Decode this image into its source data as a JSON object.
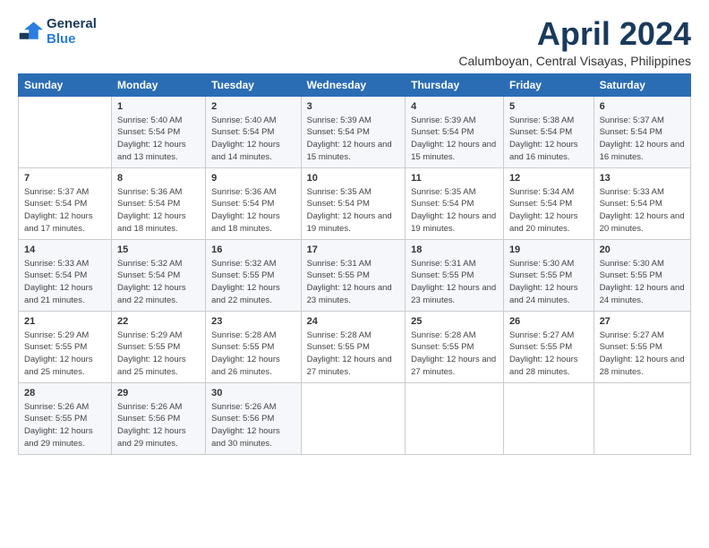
{
  "logo": {
    "line1": "General",
    "line2": "Blue"
  },
  "title": "April 2024",
  "subtitle": "Calumboyan, Central Visayas, Philippines",
  "weekdays": [
    "Sunday",
    "Monday",
    "Tuesday",
    "Wednesday",
    "Thursday",
    "Friday",
    "Saturday"
  ],
  "weeks": [
    [
      {
        "day": "",
        "sunrise": "",
        "sunset": "",
        "daylight": ""
      },
      {
        "day": "1",
        "sunrise": "Sunrise: 5:40 AM",
        "sunset": "Sunset: 5:54 PM",
        "daylight": "Daylight: 12 hours and 13 minutes."
      },
      {
        "day": "2",
        "sunrise": "Sunrise: 5:40 AM",
        "sunset": "Sunset: 5:54 PM",
        "daylight": "Daylight: 12 hours and 14 minutes."
      },
      {
        "day": "3",
        "sunrise": "Sunrise: 5:39 AM",
        "sunset": "Sunset: 5:54 PM",
        "daylight": "Daylight: 12 hours and 15 minutes."
      },
      {
        "day": "4",
        "sunrise": "Sunrise: 5:39 AM",
        "sunset": "Sunset: 5:54 PM",
        "daylight": "Daylight: 12 hours and 15 minutes."
      },
      {
        "day": "5",
        "sunrise": "Sunrise: 5:38 AM",
        "sunset": "Sunset: 5:54 PM",
        "daylight": "Daylight: 12 hours and 16 minutes."
      },
      {
        "day": "6",
        "sunrise": "Sunrise: 5:37 AM",
        "sunset": "Sunset: 5:54 PM",
        "daylight": "Daylight: 12 hours and 16 minutes."
      }
    ],
    [
      {
        "day": "7",
        "sunrise": "Sunrise: 5:37 AM",
        "sunset": "Sunset: 5:54 PM",
        "daylight": "Daylight: 12 hours and 17 minutes."
      },
      {
        "day": "8",
        "sunrise": "Sunrise: 5:36 AM",
        "sunset": "Sunset: 5:54 PM",
        "daylight": "Daylight: 12 hours and 18 minutes."
      },
      {
        "day": "9",
        "sunrise": "Sunrise: 5:36 AM",
        "sunset": "Sunset: 5:54 PM",
        "daylight": "Daylight: 12 hours and 18 minutes."
      },
      {
        "day": "10",
        "sunrise": "Sunrise: 5:35 AM",
        "sunset": "Sunset: 5:54 PM",
        "daylight": "Daylight: 12 hours and 19 minutes."
      },
      {
        "day": "11",
        "sunrise": "Sunrise: 5:35 AM",
        "sunset": "Sunset: 5:54 PM",
        "daylight": "Daylight: 12 hours and 19 minutes."
      },
      {
        "day": "12",
        "sunrise": "Sunrise: 5:34 AM",
        "sunset": "Sunset: 5:54 PM",
        "daylight": "Daylight: 12 hours and 20 minutes."
      },
      {
        "day": "13",
        "sunrise": "Sunrise: 5:33 AM",
        "sunset": "Sunset: 5:54 PM",
        "daylight": "Daylight: 12 hours and 20 minutes."
      }
    ],
    [
      {
        "day": "14",
        "sunrise": "Sunrise: 5:33 AM",
        "sunset": "Sunset: 5:54 PM",
        "daylight": "Daylight: 12 hours and 21 minutes."
      },
      {
        "day": "15",
        "sunrise": "Sunrise: 5:32 AM",
        "sunset": "Sunset: 5:54 PM",
        "daylight": "Daylight: 12 hours and 22 minutes."
      },
      {
        "day": "16",
        "sunrise": "Sunrise: 5:32 AM",
        "sunset": "Sunset: 5:55 PM",
        "daylight": "Daylight: 12 hours and 22 minutes."
      },
      {
        "day": "17",
        "sunrise": "Sunrise: 5:31 AM",
        "sunset": "Sunset: 5:55 PM",
        "daylight": "Daylight: 12 hours and 23 minutes."
      },
      {
        "day": "18",
        "sunrise": "Sunrise: 5:31 AM",
        "sunset": "Sunset: 5:55 PM",
        "daylight": "Daylight: 12 hours and 23 minutes."
      },
      {
        "day": "19",
        "sunrise": "Sunrise: 5:30 AM",
        "sunset": "Sunset: 5:55 PM",
        "daylight": "Daylight: 12 hours and 24 minutes."
      },
      {
        "day": "20",
        "sunrise": "Sunrise: 5:30 AM",
        "sunset": "Sunset: 5:55 PM",
        "daylight": "Daylight: 12 hours and 24 minutes."
      }
    ],
    [
      {
        "day": "21",
        "sunrise": "Sunrise: 5:29 AM",
        "sunset": "Sunset: 5:55 PM",
        "daylight": "Daylight: 12 hours and 25 minutes."
      },
      {
        "day": "22",
        "sunrise": "Sunrise: 5:29 AM",
        "sunset": "Sunset: 5:55 PM",
        "daylight": "Daylight: 12 hours and 25 minutes."
      },
      {
        "day": "23",
        "sunrise": "Sunrise: 5:28 AM",
        "sunset": "Sunset: 5:55 PM",
        "daylight": "Daylight: 12 hours and 26 minutes."
      },
      {
        "day": "24",
        "sunrise": "Sunrise: 5:28 AM",
        "sunset": "Sunset: 5:55 PM",
        "daylight": "Daylight: 12 hours and 27 minutes."
      },
      {
        "day": "25",
        "sunrise": "Sunrise: 5:28 AM",
        "sunset": "Sunset: 5:55 PM",
        "daylight": "Daylight: 12 hours and 27 minutes."
      },
      {
        "day": "26",
        "sunrise": "Sunrise: 5:27 AM",
        "sunset": "Sunset: 5:55 PM",
        "daylight": "Daylight: 12 hours and 28 minutes."
      },
      {
        "day": "27",
        "sunrise": "Sunrise: 5:27 AM",
        "sunset": "Sunset: 5:55 PM",
        "daylight": "Daylight: 12 hours and 28 minutes."
      }
    ],
    [
      {
        "day": "28",
        "sunrise": "Sunrise: 5:26 AM",
        "sunset": "Sunset: 5:55 PM",
        "daylight": "Daylight: 12 hours and 29 minutes."
      },
      {
        "day": "29",
        "sunrise": "Sunrise: 5:26 AM",
        "sunset": "Sunset: 5:56 PM",
        "daylight": "Daylight: 12 hours and 29 minutes."
      },
      {
        "day": "30",
        "sunrise": "Sunrise: 5:26 AM",
        "sunset": "Sunset: 5:56 PM",
        "daylight": "Daylight: 12 hours and 30 minutes."
      },
      {
        "day": "",
        "sunrise": "",
        "sunset": "",
        "daylight": ""
      },
      {
        "day": "",
        "sunrise": "",
        "sunset": "",
        "daylight": ""
      },
      {
        "day": "",
        "sunrise": "",
        "sunset": "",
        "daylight": ""
      },
      {
        "day": "",
        "sunrise": "",
        "sunset": "",
        "daylight": ""
      }
    ]
  ]
}
